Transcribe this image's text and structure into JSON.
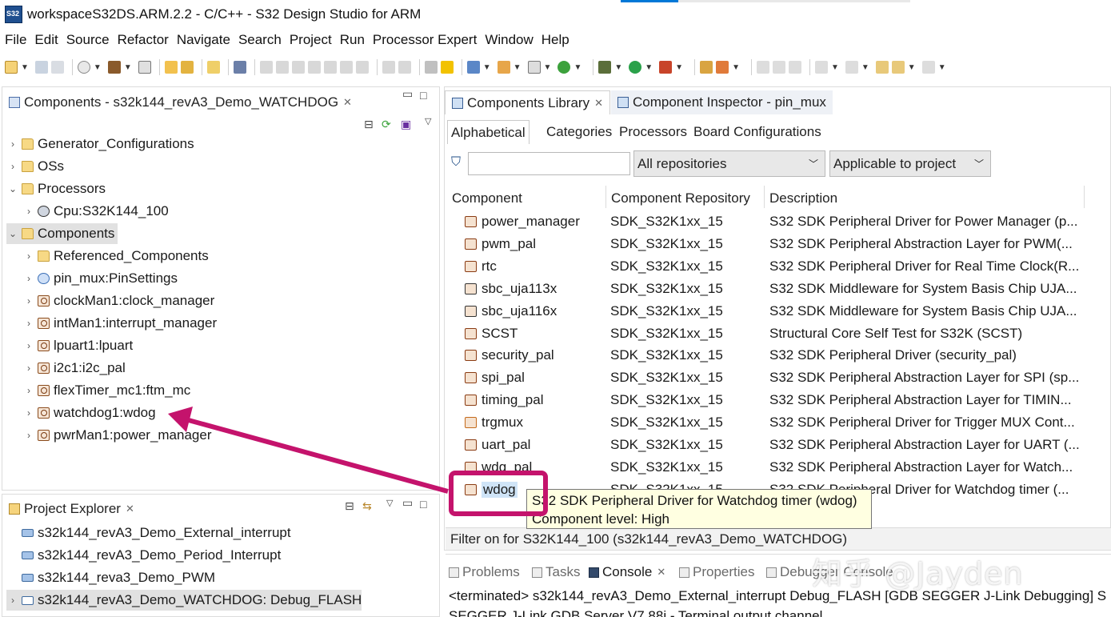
{
  "window": {
    "title": "workspaceS32DS.ARM.2.2 - C/C++ - S32 Design Studio for ARM"
  },
  "menu": [
    "File",
    "Edit",
    "Source",
    "Refactor",
    "Navigate",
    "Search",
    "Project",
    "Run",
    "Processor Expert",
    "Window",
    "Help"
  ],
  "components_view": {
    "tab_title": "Components - s32k144_revA3_Demo_WATCHDOG",
    "tree": [
      {
        "label": "Generator_Configurations",
        "icon": "folder-icon",
        "twist": ">"
      },
      {
        "label": "OSs",
        "icon": "folder-icon",
        "twist": ">"
      },
      {
        "label": "Processors",
        "icon": "folder-icon",
        "twist": "v"
      },
      {
        "label": "Cpu:S32K144_100",
        "icon": "cpu-icon",
        "twist": ">"
      },
      {
        "label": "Components",
        "icon": "folder-icon",
        "twist": "v"
      },
      {
        "label": "Referenced_Components",
        "icon": "folder-icon",
        "twist": ">"
      },
      {
        "label": "pin_mux:PinSettings",
        "icon": "pin-icon",
        "twist": ">"
      },
      {
        "label": "clockMan1:clock_manager",
        "icon": "component-icon",
        "twist": ">"
      },
      {
        "label": "intMan1:interrupt_manager",
        "icon": "component-icon",
        "twist": ">"
      },
      {
        "label": "lpuart1:lpuart",
        "icon": "component-icon",
        "twist": ">"
      },
      {
        "label": "i2c1:i2c_pal",
        "icon": "component-icon",
        "twist": ">"
      },
      {
        "label": "flexTimer_mc1:ftm_mc",
        "icon": "component-icon",
        "twist": ">"
      },
      {
        "label": "watchdog1:wdog",
        "icon": "component-icon",
        "twist": ">"
      },
      {
        "label": "pwrMan1:power_manager",
        "icon": "component-icon",
        "twist": ">"
      }
    ]
  },
  "project_explorer": {
    "tab_title": "Project Explorer",
    "items": [
      {
        "label": "s32k144_revA3_Demo_External_interrupt",
        "twist": ""
      },
      {
        "label": "s32k144_revA3_Demo_Period_Interrupt",
        "twist": ""
      },
      {
        "label": "s32k144_reva3_Demo_PWM",
        "twist": ""
      },
      {
        "label": "s32k144_revA3_Demo_WATCHDOG: Debug_FLASH",
        "twist": ">"
      }
    ]
  },
  "library": {
    "tab_library": "Components Library",
    "tab_inspector": "Component Inspector - pin_mux",
    "subtabs": [
      "Alphabetical",
      "Categories",
      "Processors",
      "Board Configurations"
    ],
    "repo_filter": "All repositories",
    "scope_filter": "Applicable to project",
    "columns": [
      "Component",
      "Component Repository",
      "Description"
    ],
    "rows": [
      {
        "name": "power_manager",
        "repo": "SDK_S32K1xx_15",
        "desc": "S32 SDK Peripheral Driver for Power Manager (p..."
      },
      {
        "name": "pwm_pal",
        "repo": "SDK_S32K1xx_15",
        "desc": "S32 SDK Peripheral Abstraction Layer for PWM(..."
      },
      {
        "name": "rtc",
        "repo": "SDK_S32K1xx_15",
        "desc": "S32 SDK Peripheral Driver for Real Time Clock(R..."
      },
      {
        "name": "sbc_uja113x",
        "repo": "SDK_S32K1xx_15",
        "desc": "S32 SDK Middleware for System Basis Chip UJA..."
      },
      {
        "name": "sbc_uja116x",
        "repo": "SDK_S32K1xx_15",
        "desc": "S32 SDK Middleware for System Basis Chip UJA..."
      },
      {
        "name": "SCST",
        "repo": "SDK_S32K1xx_15",
        "desc": "Structural Core Self Test for S32K (SCST)"
      },
      {
        "name": "security_pal",
        "repo": "SDK_S32K1xx_15",
        "desc": "S32 SDK Peripheral Driver (security_pal)"
      },
      {
        "name": "spi_pal",
        "repo": "SDK_S32K1xx_15",
        "desc": "S32 SDK Peripheral Abstraction Layer for SPI (sp..."
      },
      {
        "name": "timing_pal",
        "repo": "SDK_S32K1xx_15",
        "desc": "S32 SDK Peripheral Abstraction Layer for TIMIN..."
      },
      {
        "name": "trgmux",
        "repo": "SDK_S32K1xx_15",
        "desc": "S32 SDK Peripheral Driver for Trigger MUX Cont..."
      },
      {
        "name": "uart_pal",
        "repo": "SDK_S32K1xx_15",
        "desc": "S32 SDK Peripheral Abstraction Layer for UART (..."
      },
      {
        "name": "wdg_pal",
        "repo": "SDK_S32K1xx_15",
        "desc": "S32 SDK Peripheral Abstraction Layer for Watch..."
      },
      {
        "name": "wdog",
        "repo": "SDK_S32K1xx_15",
        "desc": "S32 SDK Peripheral Driver for Watchdog timer (..."
      }
    ],
    "tooltip": {
      "line1": "S32 SDK Peripheral Driver for Watchdog timer (wdog)",
      "line2": "Component level: High"
    },
    "status": "Filter on for S32K144_100 (s32k144_revA3_Demo_WATCHDOG)"
  },
  "bottom": {
    "tabs": [
      "Problems",
      "Tasks",
      "Console",
      "Properties",
      "Debugger Console"
    ],
    "console_line": "<terminated> s32k144_revA3_Demo_External_interrupt Debug_FLASH [GDB SEGGER J-Link Debugging] S",
    "console_line2": "SEGGER J-Link GDB Server V7.88i - Terminal output channel"
  },
  "watermark": "知乎 @Jayden",
  "colors": {
    "highlight": "#c4136c",
    "tooltip_bg": "#ffffe1",
    "selection": "#e1e1e1"
  }
}
